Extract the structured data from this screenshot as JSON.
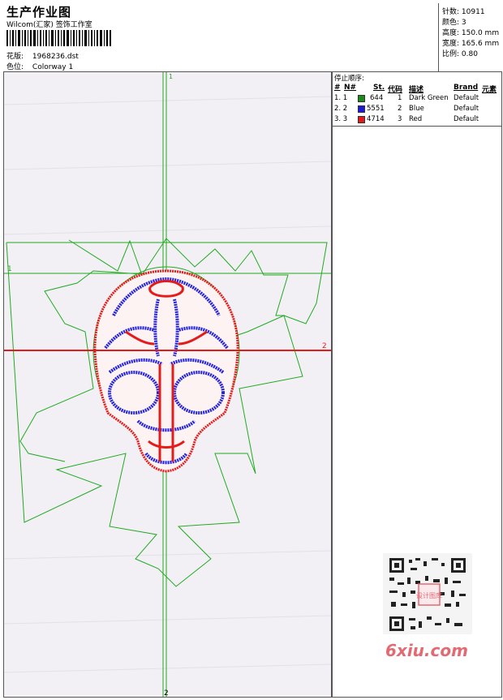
{
  "header": {
    "title": "生产作业图",
    "company": "Wilcom(汇家) 签饰工作室",
    "design_label": "花版:",
    "design_value": "1968236.dst",
    "colorway_label": "色位:",
    "colorway_value": "Colorway 1"
  },
  "info": {
    "stitches_label": "针数:",
    "stitches_value": "10911",
    "colors_label": "颜色:",
    "colors_value": "3",
    "height_label": "高度:",
    "height_value": "150.0 mm",
    "width_label": "宽度:",
    "width_value": "165.6 mm",
    "scale_label": "比例:",
    "scale_value": "0.80"
  },
  "guides": {
    "v_top": "1",
    "v_bottom": "2",
    "h_left": "1",
    "h_right": "2"
  },
  "stop_sequence": {
    "title": "停止顺序:",
    "columns": [
      "#",
      "N#",
      "St.",
      "代码",
      "描述",
      "Brand",
      "元素"
    ],
    "rows": [
      {
        "idx": "1. 1",
        "color": "#1a8a1a",
        "st": "644",
        "code": "1",
        "desc": "Dark Green",
        "brand": "Default"
      },
      {
        "idx": "2. 2",
        "color": "#1a1ad8",
        "st": "5551",
        "code": "2",
        "desc": "Blue",
        "brand": "Default"
      },
      {
        "idx": "3. 3",
        "color": "#e01a1a",
        "st": "4714",
        "code": "3",
        "desc": "Red",
        "brand": "Default"
      }
    ]
  },
  "watermark": {
    "text": "6xiu.com",
    "stamp": "设计图库"
  },
  "colors": {
    "green": "#22aa22",
    "blue": "#2222dd",
    "red": "#e41b1b",
    "panel_bg": "#f2f0f4"
  }
}
